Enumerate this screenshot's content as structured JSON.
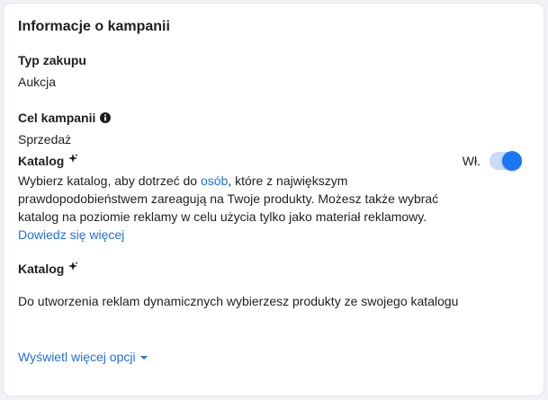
{
  "section": {
    "title": "Informacje o kampanii"
  },
  "purchase_type": {
    "label": "Typ zakupu",
    "value": "Aukcja"
  },
  "campaign_objective": {
    "label": "Cel kampanii",
    "value": "Sprzedaż",
    "info_icon": "info-icon"
  },
  "catalog_toggle": {
    "label": "Katalog",
    "icon": "sparkle-icon",
    "toggle_label": "Wł.",
    "enabled": true,
    "description_part1": "Wybierz katalog, aby dotrzeć do ",
    "description_link": "osób",
    "description_part2": ", które z największym prawdopodobieństwem zareagują na Twoje produkty. Możesz także wybrać katalog na poziomie reklamy w celu użycia tylko jako materiał reklamowy.",
    "learn_more": "Dowiedz się więcej"
  },
  "catalog_info": {
    "label": "Katalog",
    "icon": "sparkle-icon",
    "text": "Do utworzenia reklam dynamicznych wybierzesz produkty ze swojego katalogu"
  },
  "more_options": {
    "label": "Wyświetl więcej opcji",
    "icon": "caret-down-icon"
  },
  "colors": {
    "accent": "#1877f2",
    "link": "#216fdb",
    "text": "#1c1e21",
    "background": "#f0f2f5"
  }
}
